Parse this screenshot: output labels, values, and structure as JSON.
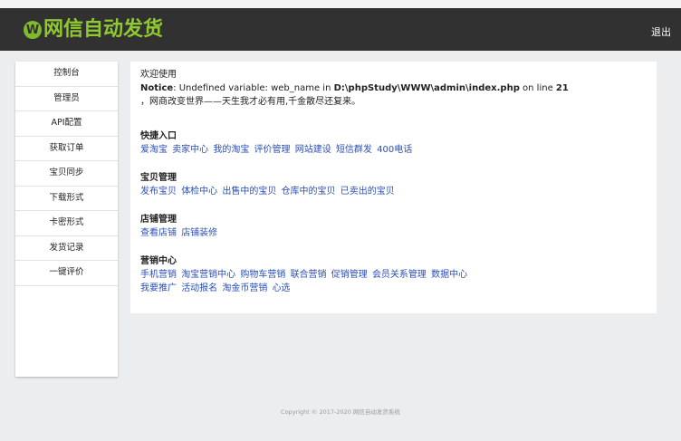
{
  "header": {
    "logo_letter": "W",
    "title": "网信自动发货",
    "logout_label": "退出",
    "logo_color": "#8fc831",
    "bg_color": "#313131"
  },
  "sidebar": {
    "items": [
      {
        "label": "控制台"
      },
      {
        "label": "管理员"
      },
      {
        "label": "API配置"
      },
      {
        "label": "获取订单"
      },
      {
        "label": "宝贝同步"
      },
      {
        "label": "下载形式"
      },
      {
        "label": "卡密形式"
      },
      {
        "label": "发货记录"
      },
      {
        "label": "一键评价"
      }
    ]
  },
  "main": {
    "welcome": "欢迎使用",
    "notice": {
      "label": "Notice",
      "text1": ": Undefined variable: web_name in ",
      "path": "D:\\phpStudy\\WWW\\admin\\index.php",
      "text2": " on line ",
      "line": "21"
    },
    "slogan": "，网商改变世界——天生我才必有用,千金散尽还复来。",
    "sections": [
      {
        "title": "快捷入口",
        "links": [
          [
            "爱淘宝",
            "卖家中心",
            "我的淘宝",
            "评价管理",
            "网站建设",
            "短信群发",
            "400电话"
          ]
        ]
      },
      {
        "title": "宝贝管理",
        "links": [
          [
            "发布宝贝",
            "体检中心",
            "出售中的宝贝",
            "仓库中的宝贝",
            "已卖出的宝贝"
          ]
        ]
      },
      {
        "title": "店铺管理",
        "links": [
          [
            "查看店铺",
            "店铺装修"
          ]
        ]
      },
      {
        "title": "营销中心",
        "links": [
          [
            "手机营销",
            "淘宝营销中心",
            "购物车营销",
            "联合营销",
            "促销管理",
            "会员关系管理",
            "数据中心"
          ],
          [
            "我要推广",
            "活动报名",
            "淘金币营销",
            "心选"
          ]
        ]
      }
    ]
  },
  "footer": {
    "copyright": "Copyright © 2017-2020 网信自动发货系统"
  },
  "colors": {
    "link": "#2b4fb5",
    "page_bg": "#ecedee"
  }
}
